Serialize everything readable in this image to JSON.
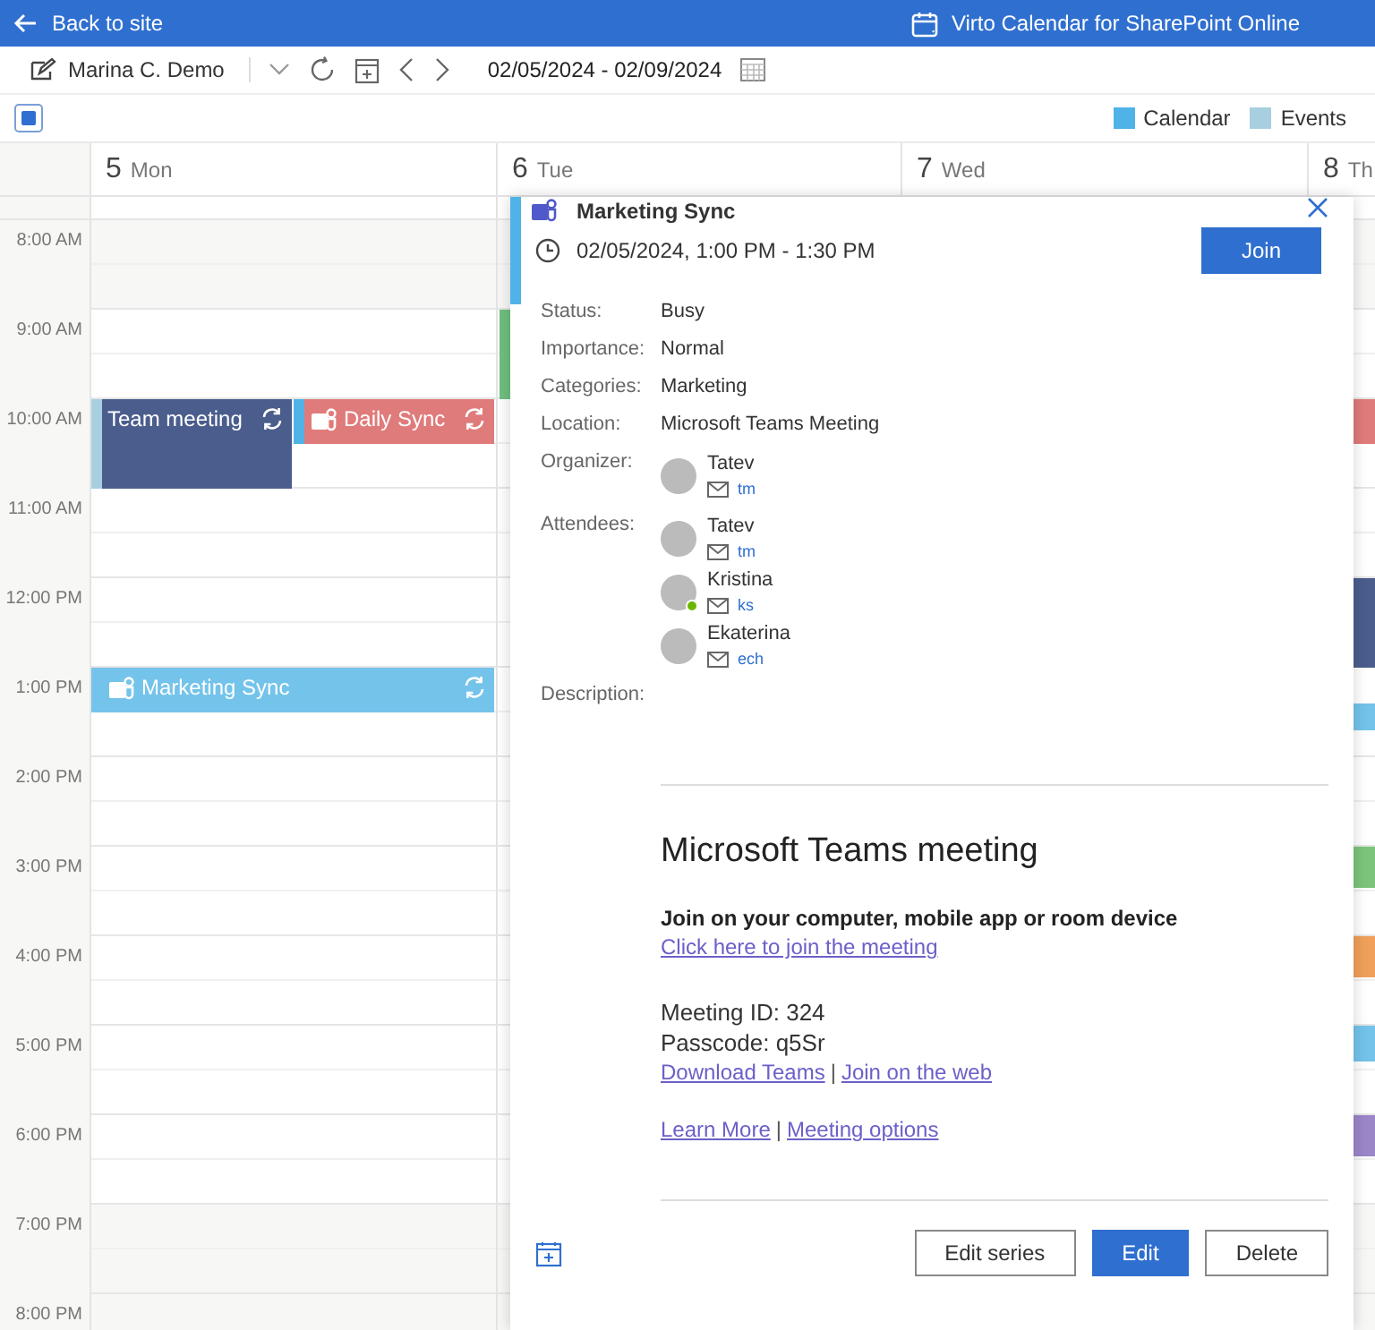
{
  "header": {
    "back": "Back to site",
    "app_title": "Virto Calendar for SharePoint Online"
  },
  "toolbar": {
    "user": "Marina C. Demo",
    "date_range": "02/05/2024 - 02/09/2024"
  },
  "legend": [
    {
      "label": "Calendar",
      "color": "#4fb3e8"
    },
    {
      "label": "Events",
      "color": "#a8cfe0"
    }
  ],
  "times": [
    "8:00 AM",
    "9:00 AM",
    "10:00 AM",
    "11:00 AM",
    "12:00 PM",
    "1:00 PM",
    "2:00 PM",
    "3:00 PM",
    "4:00 PM",
    "5:00 PM",
    "6:00 PM",
    "7:00 PM",
    "8:00 PM"
  ],
  "days": [
    {
      "number": "5",
      "name": "Mon",
      "events": [
        {
          "title": "Team meeting",
          "kind": "event",
          "color": "#4a5d8c",
          "teams": false,
          "recurring": true
        },
        {
          "title": "Daily Sync",
          "kind": "calendar",
          "color": "#e07b7b",
          "teams": true,
          "recurring": true
        },
        {
          "title": "Marketing Sync",
          "color": "#74c3ea",
          "teams": true,
          "recurring": true
        }
      ]
    },
    {
      "number": "6",
      "name": "Tue",
      "events": [
        {
          "color": "#6fbf7f"
        }
      ]
    },
    {
      "number": "7",
      "name": "Wed"
    },
    {
      "number": "8",
      "name": "Th",
      "events": [
        {
          "color": "#e07b7b"
        },
        {
          "color": "#4a5d8c"
        },
        {
          "color": "#74c3ea"
        },
        {
          "color": "#7cc47c"
        },
        {
          "color": "#f0a05a"
        },
        {
          "color": "#74c3ea"
        },
        {
          "color": "#9b86c9"
        }
      ]
    }
  ],
  "popup": {
    "title": "Marketing Sync",
    "when": "02/05/2024, 1:00 PM - 1:30 PM",
    "join": "Join",
    "details": [
      {
        "label": "Status:",
        "value": "Busy"
      },
      {
        "label": "Importance:",
        "value": "Normal"
      },
      {
        "label": "Categories:",
        "value": "Marketing"
      },
      {
        "label": "Location:",
        "value": "Microsoft Teams Meeting"
      }
    ],
    "organizer": {
      "label": "Organizer:",
      "people": [
        {
          "name": "Tatev",
          "email": "tm",
          "online": false
        }
      ]
    },
    "attendees": {
      "label": "Attendees:",
      "people": [
        {
          "name": "Tatev",
          "email": "tm",
          "online": false
        },
        {
          "name": "Kristina",
          "email": "ks",
          "online": true
        },
        {
          "name": "Ekaterina",
          "email": "ech",
          "online": false
        }
      ]
    },
    "description_label": "Description:",
    "meeting": {
      "heading": "Microsoft Teams meeting",
      "subheading": "Join on your computer, mobile app or room device",
      "join_link": "Click here to join the meeting",
      "meeting_id": "Meeting ID: 324",
      "passcode": "Passcode: q5Sr",
      "link_rows": [
        {
          "links": [
            "Download Teams",
            "Join on the web"
          ],
          "separator": "|"
        },
        {
          "links": [
            "Learn More",
            "Meeting options"
          ],
          "separator": "|"
        }
      ]
    },
    "buttons": [
      {
        "label": "Edit series",
        "primary": false
      },
      {
        "label": "Edit",
        "primary": true
      },
      {
        "label": "Delete",
        "primary": false
      }
    ]
  }
}
